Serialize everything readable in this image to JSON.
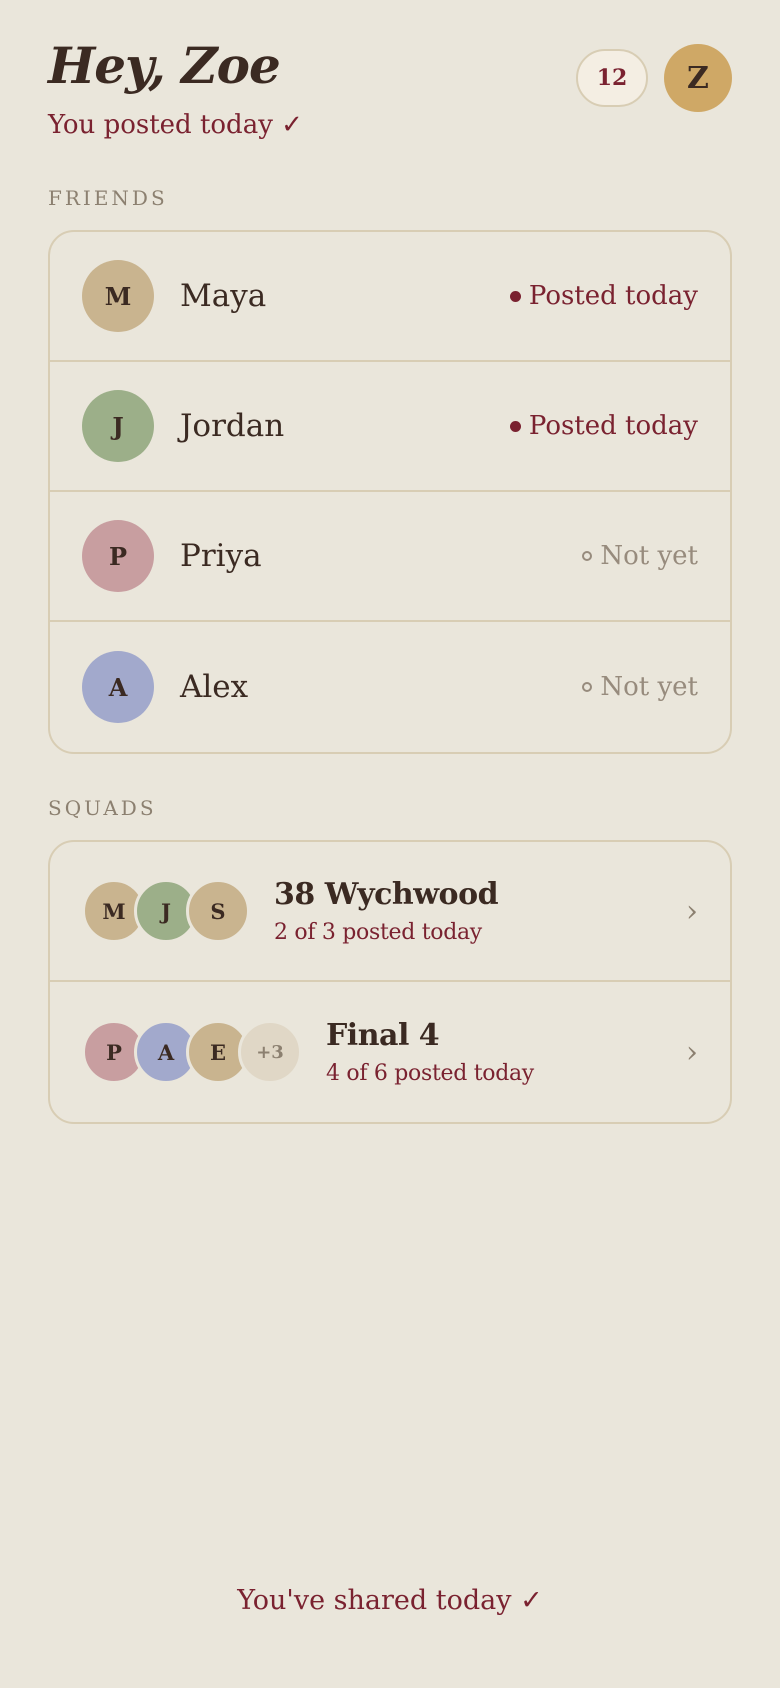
{
  "header": {
    "greeting": "Hey, Zoe",
    "status": "You posted today ✓",
    "streak_count": "12",
    "me_initial": "Z"
  },
  "friends": {
    "label": "FRIENDS",
    "items": [
      {
        "initial": "M",
        "name": "Maya",
        "status": "Posted today",
        "posted": true,
        "color": "#C9B48F"
      },
      {
        "initial": "J",
        "name": "Jordan",
        "status": "Posted today",
        "posted": true,
        "color": "#9CAF89"
      },
      {
        "initial": "P",
        "name": "Priya",
        "status": "Not yet",
        "posted": false,
        "color": "#C89EA0"
      },
      {
        "initial": "A",
        "name": "Alex",
        "status": "Not yet",
        "posted": false,
        "color": "#A2A9CC"
      }
    ]
  },
  "squads": {
    "label": "SQUADS",
    "items": [
      {
        "name": "38 Wychwood",
        "subtitle": "2 of 3 posted today",
        "members": [
          {
            "initial": "M",
            "color": "#C9B48F"
          },
          {
            "initial": "J",
            "color": "#9CAF89"
          },
          {
            "initial": "S",
            "color": "#C9B48F"
          }
        ],
        "more": ""
      },
      {
        "name": "Final 4",
        "subtitle": "4 of 6 posted today",
        "members": [
          {
            "initial": "P",
            "color": "#C89EA0"
          },
          {
            "initial": "A",
            "color": "#A2A9CC"
          },
          {
            "initial": "E",
            "color": "#C9B48F"
          }
        ],
        "more": "+3"
      }
    ]
  },
  "footer": {
    "text": "You've shared today ✓"
  },
  "icons": {
    "chevron": "›",
    "posted_dot": "filled-dot-icon",
    "notyet_dot": "hollow-dot-icon"
  }
}
